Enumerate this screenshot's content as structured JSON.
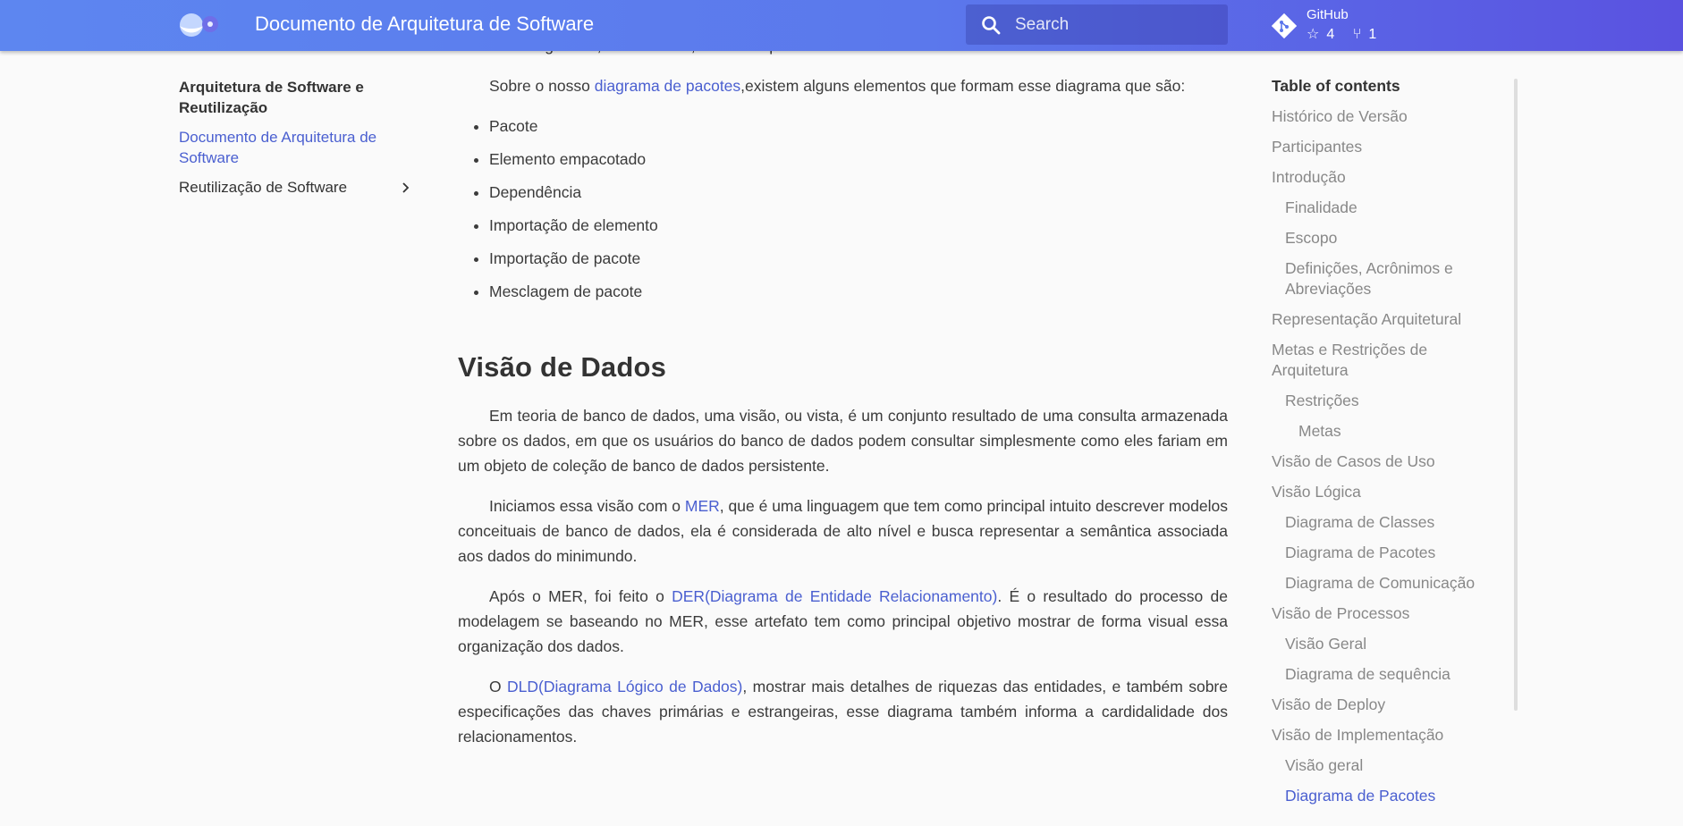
{
  "header": {
    "title": "Documento de Arquitetura de Software",
    "search_placeholder": "Search",
    "repo": {
      "name": "GitHub",
      "stars": "4",
      "forks": "1"
    },
    "colors": {
      "gradient_start": "#5d86f0",
      "gradient_end": "#5a52e0"
    }
  },
  "sidebar": {
    "section_title": "Arquitetura de Software e Reutilização",
    "items": [
      {
        "label": "Documento de Arquitetura de Software",
        "active": true
      },
      {
        "label": "Reutilização de Software",
        "active": false,
        "icon": "chevron-right-icon"
      }
    ]
  },
  "content": {
    "p0_end": "incluindo diagramas, documentos, classes e pacotes de eventos",
    "p1_pre": "Sobre o nosso ",
    "p1_link": "diagrama de pacotes",
    "p1_post": ",existem alguns elementos que formam esse diagrama que são:",
    "list": [
      "Pacote",
      "Elemento empacotado",
      "Dependência",
      "Importação de elemento",
      "Importação de pacote",
      "Mesclagem de pacote"
    ],
    "h2": "Visão de Dados",
    "p2": "Em teoria de banco de dados, uma visão, ou vista, é um conjunto resultado de uma consulta armazenada sobre os dados, em que os usuários do banco de dados podem consultar simplesmente como eles fariam em um objeto de coleção de banco de dados persistente.",
    "p3_pre": "Iniciamos essa visão com o ",
    "p3_link": "MER",
    "p3_post": ", que é uma linguagem que tem como principal intuito descrever modelos conceituais de banco de dados, ela é considerada de alto nível e busca representar a semântica associada aos dados do minimundo.",
    "p4_pre": "Após o MER, foi feito o ",
    "p4_link": "DER(Diagrama de Entidade Relacionamento)",
    "p4_post": ". É o resultado do processo de modelagem se baseando no MER, esse artefato tem como principal objetivo mostrar de forma visual essa organização dos dados.",
    "p5_pre": "O ",
    "p5_link": "DLD(Diagrama Lógico de Dados)",
    "p5_post": ", mostrar mais detalhes de riquezas das entidades, e também sobre especificações das chaves primárias e estrangeiras, esse diagrama também informa a cardidalidade dos relacionamentos."
  },
  "toc": {
    "title": "Table of contents",
    "items": [
      {
        "label": "Histórico de Versão",
        "level": 0
      },
      {
        "label": "Participantes",
        "level": 0
      },
      {
        "label": "Introdução",
        "level": 0
      },
      {
        "label": "Finalidade",
        "level": 1
      },
      {
        "label": "Escopo",
        "level": 1
      },
      {
        "label": "Definições, Acrônimos e Abreviações",
        "level": 1
      },
      {
        "label": "Representação Arquitetural",
        "level": 0
      },
      {
        "label": "Metas e Restrições de Arquitetura",
        "level": 0
      },
      {
        "label": "Restrições",
        "level": 1
      },
      {
        "label": "Metas",
        "level": 2
      },
      {
        "label": "Visão de Casos de Uso",
        "level": 0
      },
      {
        "label": "Visão Lógica",
        "level": 0
      },
      {
        "label": "Diagrama de Classes",
        "level": 1
      },
      {
        "label": "Diagrama de Pacotes",
        "level": 1
      },
      {
        "label": "Diagrama de Comunicação",
        "level": 1
      },
      {
        "label": "Visão de Processos",
        "level": 0
      },
      {
        "label": "Visão Geral",
        "level": 1
      },
      {
        "label": "Diagrama de sequência",
        "level": 1
      },
      {
        "label": "Visão de Deploy",
        "level": 0
      },
      {
        "label": "Visão de Implementação",
        "level": 0
      },
      {
        "label": "Visão geral",
        "level": 1
      },
      {
        "label": "Diagrama de Pacotes",
        "level": 1,
        "active": true
      }
    ]
  }
}
